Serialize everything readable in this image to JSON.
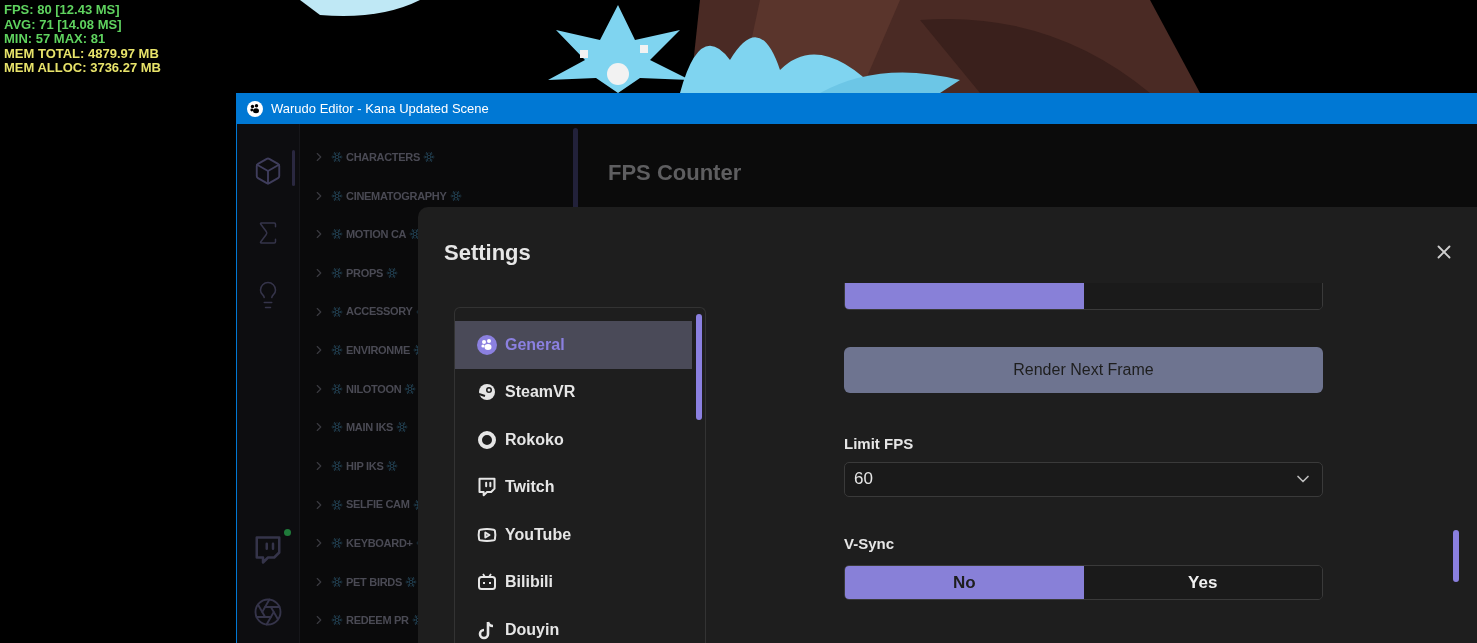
{
  "overlay_stats": [
    {
      "text": "FPS: 80 [12.43 MS]",
      "color": "#5fd35f"
    },
    {
      "text": "AVG: 71 [14.08 MS]",
      "color": "#5fd35f"
    },
    {
      "text": "MIN: 57 MAX: 81",
      "color": "#5fd35f"
    },
    {
      "text": "MEM TOTAL: 4879.97 MB",
      "color": "#e8e36a"
    },
    {
      "text": "MEM ALLOC: 3736.27 MB",
      "color": "#e8e36a"
    }
  ],
  "window": {
    "title": "Warudo Editor - Kana Updated Scene"
  },
  "rail_top": [
    {
      "kind": "cube",
      "selected": true
    },
    {
      "kind": "sigma",
      "selected": false
    },
    {
      "kind": "bulb",
      "selected": false
    }
  ],
  "rail_bottom": [
    {
      "kind": "twitch",
      "selected": false
    },
    {
      "kind": "aperture",
      "selected": false
    }
  ],
  "tree": [
    {
      "label": "CHARACTERS"
    },
    {
      "label": "CINEMATOGRAPHY"
    },
    {
      "label": "MOTION CA"
    },
    {
      "label": "PROPS"
    },
    {
      "label": "ACCESSORY"
    },
    {
      "label": "ENVIRONME"
    },
    {
      "label": "NILOTOON"
    },
    {
      "label": "MAIN IKS"
    },
    {
      "label": "HIP IKS"
    },
    {
      "label": "SELFIE CAM"
    },
    {
      "label": "KEYBOARD+"
    },
    {
      "label": "PET BIRDS"
    },
    {
      "label": "REDEEM PR"
    }
  ],
  "main": {
    "heading": "FPS Counter"
  },
  "settings": {
    "title": "Settings",
    "nav": [
      {
        "label": "General",
        "kind": "general",
        "selected": true
      },
      {
        "label": "SteamVR",
        "kind": "steam",
        "selected": false
      },
      {
        "label": "Rokoko",
        "kind": "rokoko",
        "selected": false
      },
      {
        "label": "Twitch",
        "kind": "twitch",
        "selected": false
      },
      {
        "label": "YouTube",
        "kind": "youtube",
        "selected": false
      },
      {
        "label": "Bilibili",
        "kind": "bilibili",
        "selected": false
      },
      {
        "label": "Douyin",
        "kind": "douyin",
        "selected": false
      }
    ],
    "partial_toggle": [
      {
        "selected": true
      },
      {
        "selected": false
      }
    ],
    "action_button": "Render Next Frame",
    "limit_fps": {
      "label": "Limit FPS",
      "value": "60"
    },
    "vsync": {
      "label": "V-Sync",
      "options": [
        {
          "label": "No",
          "selected": true
        },
        {
          "label": "Yes",
          "selected": false
        }
      ]
    }
  }
}
